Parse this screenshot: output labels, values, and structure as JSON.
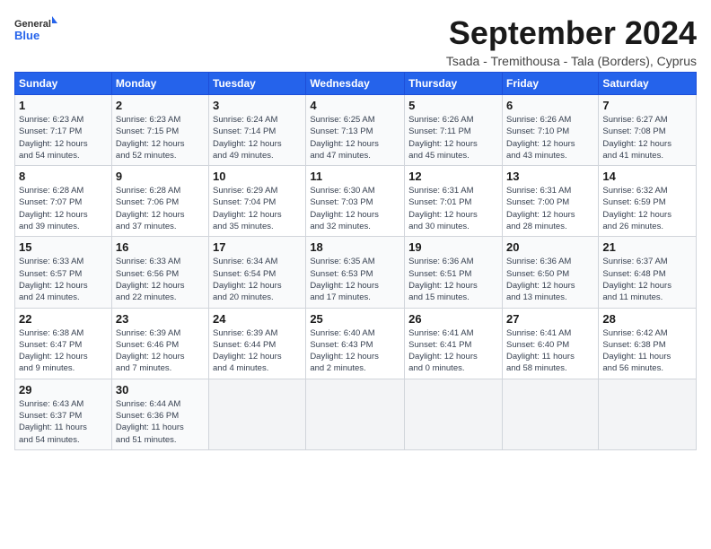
{
  "header": {
    "logo_general": "General",
    "logo_blue": "Blue",
    "month_title": "September 2024",
    "subtitle": "Tsada - Tremithousa - Tala (Borders), Cyprus"
  },
  "weekdays": [
    "Sunday",
    "Monday",
    "Tuesday",
    "Wednesday",
    "Thursday",
    "Friday",
    "Saturday"
  ],
  "weeks": [
    [
      {
        "day": "1",
        "sunrise": "6:23 AM",
        "sunset": "7:17 PM",
        "daylight": "12 hours and 54 minutes."
      },
      {
        "day": "2",
        "sunrise": "6:23 AM",
        "sunset": "7:15 PM",
        "daylight": "12 hours and 52 minutes."
      },
      {
        "day": "3",
        "sunrise": "6:24 AM",
        "sunset": "7:14 PM",
        "daylight": "12 hours and 49 minutes."
      },
      {
        "day": "4",
        "sunrise": "6:25 AM",
        "sunset": "7:13 PM",
        "daylight": "12 hours and 47 minutes."
      },
      {
        "day": "5",
        "sunrise": "6:26 AM",
        "sunset": "7:11 PM",
        "daylight": "12 hours and 45 minutes."
      },
      {
        "day": "6",
        "sunrise": "6:26 AM",
        "sunset": "7:10 PM",
        "daylight": "12 hours and 43 minutes."
      },
      {
        "day": "7",
        "sunrise": "6:27 AM",
        "sunset": "7:08 PM",
        "daylight": "12 hours and 41 minutes."
      }
    ],
    [
      {
        "day": "8",
        "sunrise": "6:28 AM",
        "sunset": "7:07 PM",
        "daylight": "12 hours and 39 minutes."
      },
      {
        "day": "9",
        "sunrise": "6:28 AM",
        "sunset": "7:06 PM",
        "daylight": "12 hours and 37 minutes."
      },
      {
        "day": "10",
        "sunrise": "6:29 AM",
        "sunset": "7:04 PM",
        "daylight": "12 hours and 35 minutes."
      },
      {
        "day": "11",
        "sunrise": "6:30 AM",
        "sunset": "7:03 PM",
        "daylight": "12 hours and 32 minutes."
      },
      {
        "day": "12",
        "sunrise": "6:31 AM",
        "sunset": "7:01 PM",
        "daylight": "12 hours and 30 minutes."
      },
      {
        "day": "13",
        "sunrise": "6:31 AM",
        "sunset": "7:00 PM",
        "daylight": "12 hours and 28 minutes."
      },
      {
        "day": "14",
        "sunrise": "6:32 AM",
        "sunset": "6:59 PM",
        "daylight": "12 hours and 26 minutes."
      }
    ],
    [
      {
        "day": "15",
        "sunrise": "6:33 AM",
        "sunset": "6:57 PM",
        "daylight": "12 hours and 24 minutes."
      },
      {
        "day": "16",
        "sunrise": "6:33 AM",
        "sunset": "6:56 PM",
        "daylight": "12 hours and 22 minutes."
      },
      {
        "day": "17",
        "sunrise": "6:34 AM",
        "sunset": "6:54 PM",
        "daylight": "12 hours and 20 minutes."
      },
      {
        "day": "18",
        "sunrise": "6:35 AM",
        "sunset": "6:53 PM",
        "daylight": "12 hours and 17 minutes."
      },
      {
        "day": "19",
        "sunrise": "6:36 AM",
        "sunset": "6:51 PM",
        "daylight": "12 hours and 15 minutes."
      },
      {
        "day": "20",
        "sunrise": "6:36 AM",
        "sunset": "6:50 PM",
        "daylight": "12 hours and 13 minutes."
      },
      {
        "day": "21",
        "sunrise": "6:37 AM",
        "sunset": "6:48 PM",
        "daylight": "12 hours and 11 minutes."
      }
    ],
    [
      {
        "day": "22",
        "sunrise": "6:38 AM",
        "sunset": "6:47 PM",
        "daylight": "12 hours and 9 minutes."
      },
      {
        "day": "23",
        "sunrise": "6:39 AM",
        "sunset": "6:46 PM",
        "daylight": "12 hours and 7 minutes."
      },
      {
        "day": "24",
        "sunrise": "6:39 AM",
        "sunset": "6:44 PM",
        "daylight": "12 hours and 4 minutes."
      },
      {
        "day": "25",
        "sunrise": "6:40 AM",
        "sunset": "6:43 PM",
        "daylight": "12 hours and 2 minutes."
      },
      {
        "day": "26",
        "sunrise": "6:41 AM",
        "sunset": "6:41 PM",
        "daylight": "12 hours and 0 minutes."
      },
      {
        "day": "27",
        "sunrise": "6:41 AM",
        "sunset": "6:40 PM",
        "daylight": "11 hours and 58 minutes."
      },
      {
        "day": "28",
        "sunrise": "6:42 AM",
        "sunset": "6:38 PM",
        "daylight": "11 hours and 56 minutes."
      }
    ],
    [
      {
        "day": "29",
        "sunrise": "6:43 AM",
        "sunset": "6:37 PM",
        "daylight": "11 hours and 54 minutes."
      },
      {
        "day": "30",
        "sunrise": "6:44 AM",
        "sunset": "6:36 PM",
        "daylight": "11 hours and 51 minutes."
      },
      null,
      null,
      null,
      null,
      null
    ]
  ]
}
